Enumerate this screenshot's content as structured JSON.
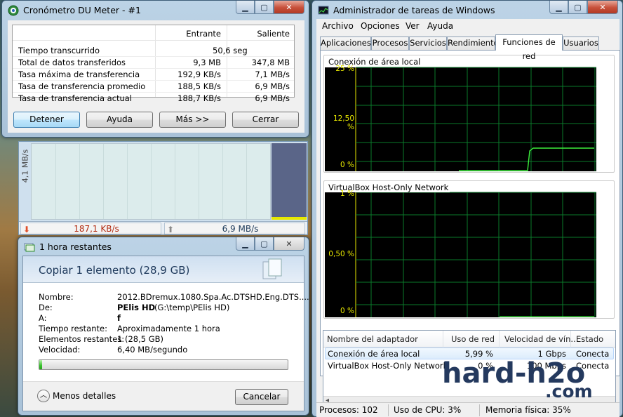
{
  "du_window": {
    "title": "Cronómetro DU Meter - #1",
    "col_in": "Entrante",
    "col_out": "Saliente",
    "rows": [
      {
        "label": "Tiempo transcurrido",
        "value": "50,6 seg"
      },
      {
        "label": "Total de datos transferidos",
        "in": "9,3 MB",
        "out": "347,8 MB"
      },
      {
        "label": "Tasa máxima de transferencia",
        "in": "192,9 KB/s",
        "out": "7,1 MB/s"
      },
      {
        "label": "Tasa de transferencia promedio",
        "in": "188,5 KB/s",
        "out": "6,9 MB/s"
      },
      {
        "label": "Tasa de transferencia actual",
        "in": "188,7 KB/s",
        "out": "6,9 MB/s"
      }
    ],
    "buttons": [
      "Detener",
      "Ayuda",
      "Más >>",
      "Cerrar"
    ]
  },
  "du_graph": {
    "y_label": "4,1 MB/s",
    "down_rate": "187,1 KB/s",
    "up_rate": "6,9 MB/s",
    "colors": {
      "graph_bg": "#dcecec",
      "dark": "#5a6588",
      "bar": "#e7e900"
    }
  },
  "copy_window": {
    "title": "1 hora restantes",
    "heading": "Copiar 1 elemento (28,9 GB)",
    "fields": [
      {
        "label": "Nombre:",
        "value": "2012.BDremux.1080.Spa.Ac.DTSHD.Eng.DTS...."
      },
      {
        "label": "De:",
        "value_bold": "PElis HD",
        "value": "(G:\\temp\\PElis HD)"
      },
      {
        "label": "A:",
        "value_bold": "f",
        "value": ""
      },
      {
        "label": "Tiempo restante:",
        "value": "Aproximadamente 1 hora"
      },
      {
        "label": "Elementos restantes:",
        "value": "1 (28,5 GB)"
      },
      {
        "label": "Velocidad:",
        "value": "6,40 MB/segundo"
      }
    ],
    "progress": 0.01,
    "less_details": "Menos detalles",
    "cancel": "Cancelar"
  },
  "task_manager": {
    "title": "Administrador de tareas de Windows",
    "menu": [
      "Archivo",
      "Opciones",
      "Ver",
      "Ayuda"
    ],
    "tabs": [
      "Aplicaciones",
      "Procesos",
      "Servicios",
      "Rendimiento",
      "Funciones de red",
      "Usuarios"
    ],
    "active_tab": "Funciones de red",
    "graphs": [
      {
        "name": "Conexión de área local",
        "y_ticks": [
          "25 %",
          "12,50 %",
          "0 %"
        ]
      },
      {
        "name": "VirtualBox Host-Only Network",
        "y_ticks": [
          "1 %",
          "0,50 %",
          "0 %"
        ]
      }
    ],
    "columns": [
      "Nombre del adaptador",
      "Uso de red",
      "Velocidad de vín...",
      "Estado"
    ],
    "adapters": [
      {
        "name": "Conexión de área local",
        "usage": "5,99 %",
        "speed": "1 Gbps",
        "state": "Conecta"
      },
      {
        "name": "VirtualBox Host-Only Network",
        "usage": "0 %",
        "speed": "100 Mbps",
        "state": "Conecta"
      }
    ],
    "status": {
      "processes": "Procesos: 102",
      "cpu": "Uso de CPU: 3%",
      "memory": "Memoria física: 35%"
    }
  },
  "watermark": {
    "main": "hard-h2o",
    "sub": ".com"
  }
}
